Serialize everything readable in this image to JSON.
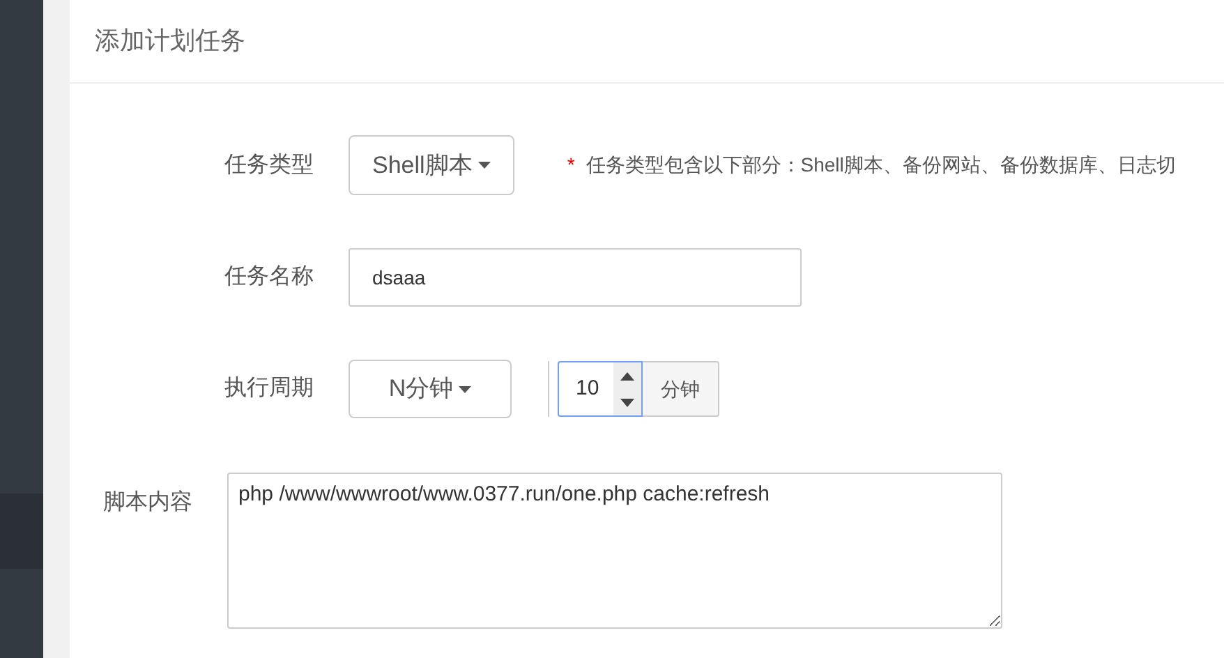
{
  "panel": {
    "title": "添加计划任务"
  },
  "form": {
    "task_type": {
      "label": "任务类型",
      "value": "Shell脚本",
      "hint_mark": "*",
      "hint": "任务类型包含以下部分：Shell脚本、备份网站、备份数据库、日志切"
    },
    "task_name": {
      "label": "任务名称",
      "value": "dsaaa"
    },
    "period": {
      "label": "执行周期",
      "value": "N分钟",
      "number": "10",
      "unit": "分钟",
      "focused": true
    },
    "script": {
      "label": "脚本内容",
      "value": "php /www/wwwroot/www.0377.run/one.php cache:refresh"
    }
  }
}
